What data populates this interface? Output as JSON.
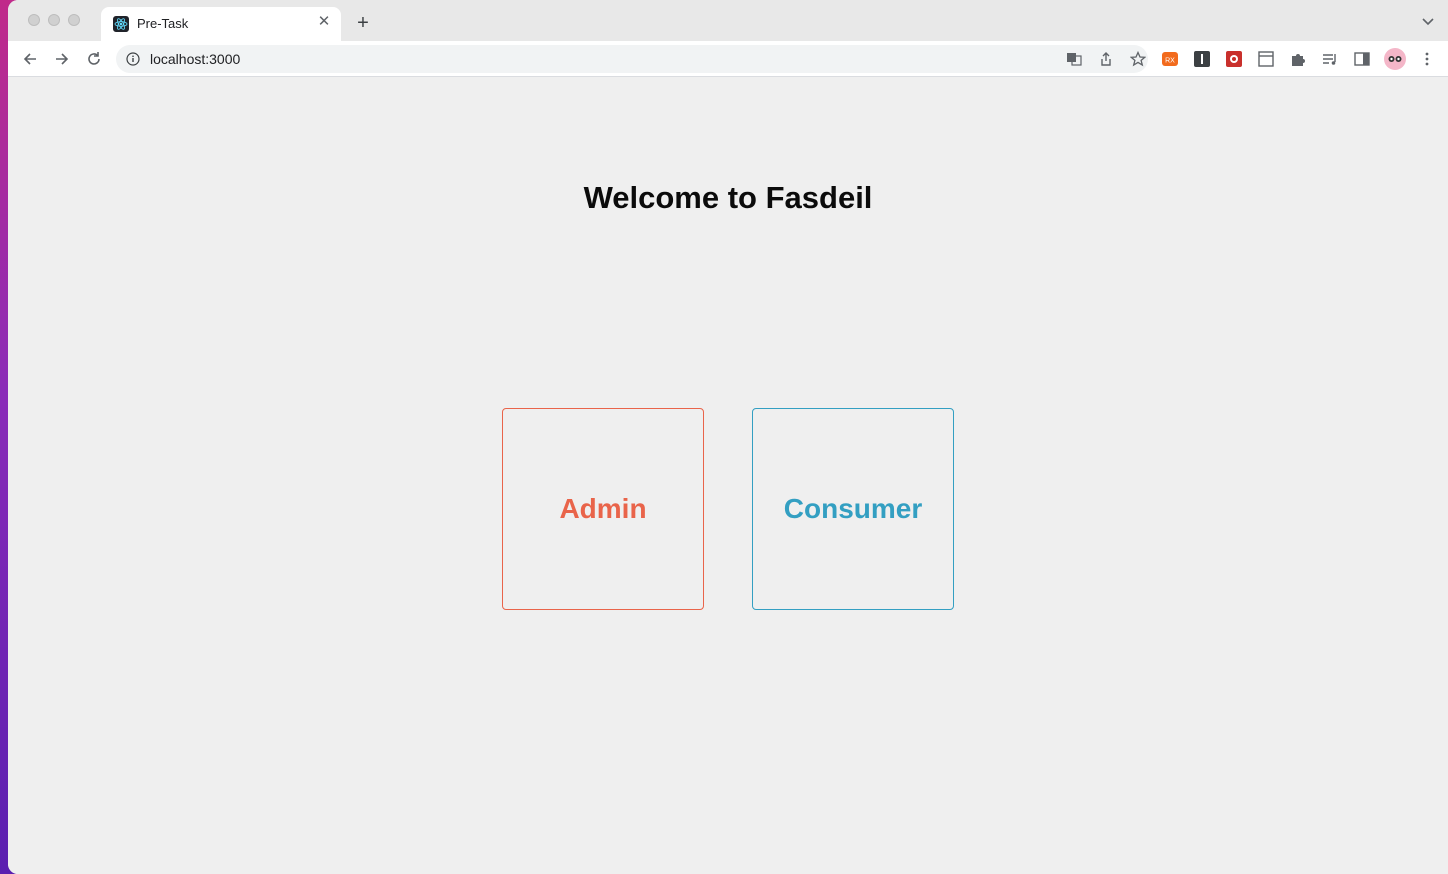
{
  "browser": {
    "tab": {
      "title": "Pre-Task",
      "favicon": "react-logo-icon"
    },
    "address": {
      "url": "localhost:3000"
    },
    "extensions": [
      "translate-icon",
      "share-icon",
      "star-icon",
      "rx-extension-icon",
      "i-extension-icon",
      "red-extension-icon",
      "window-icon",
      "puzzle-icon",
      "media-icon",
      "side-panel-icon",
      "profile-avatar",
      "kebab-menu-icon"
    ]
  },
  "page": {
    "heading": "Welcome to Fasdeil",
    "cards": [
      {
        "label": "Admin",
        "color": "#e9644a"
      },
      {
        "label": "Consumer",
        "color": "#339fc2"
      }
    ]
  }
}
